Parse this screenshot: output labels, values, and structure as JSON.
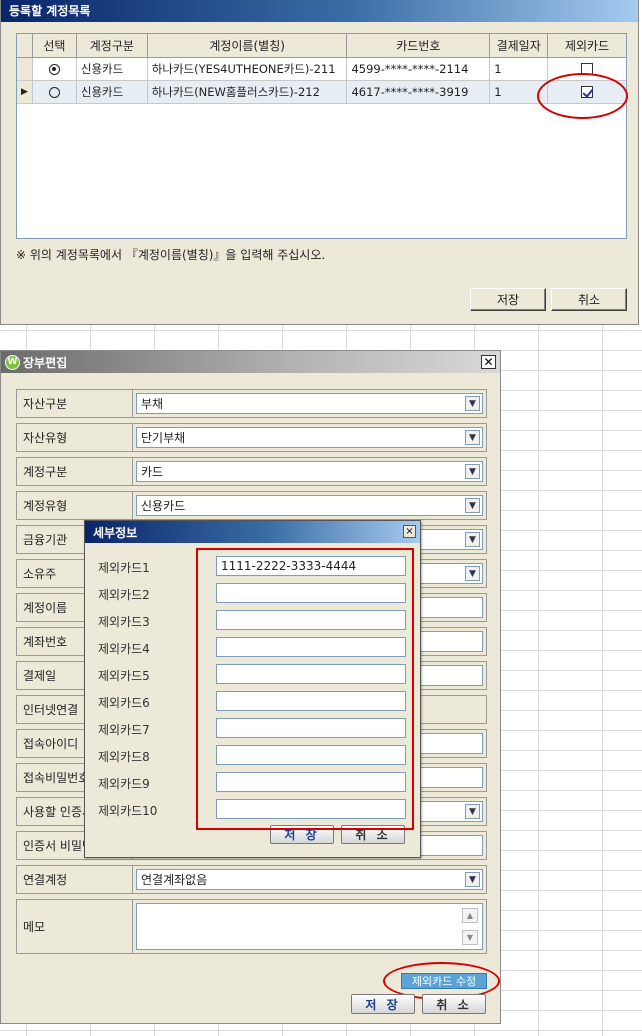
{
  "top_window": {
    "title": "등록할 계정목록",
    "columns": [
      "선택",
      "계정구분",
      "계정이름(별칭)",
      "카드번호",
      "결제일자",
      "제외카드"
    ],
    "rows": [
      {
        "selected": true,
        "account_type": "신용카드",
        "account_name": "하나카드(YES4UTHEONE카드)-211",
        "card_number": "4599-****-****-2114",
        "pay_day": "1",
        "excluded": false
      },
      {
        "selected": false,
        "account_type": "신용카드",
        "account_name": "하나카드(NEW홈플러스카드)-212",
        "card_number": "4617-****-****-3919",
        "pay_day": "1",
        "excluded": true
      }
    ],
    "notice": "※ 위의 계정목록에서 『계정이름(별칭)』을 입력해 주십시오.",
    "save_label": "저장",
    "cancel_label": "취소"
  },
  "ledger_window": {
    "title": "장부편집",
    "fields": [
      {
        "label": "자산구분",
        "value": "부채"
      },
      {
        "label": "자산유형",
        "value": "단기부채"
      },
      {
        "label": "계정구분",
        "value": "카드"
      },
      {
        "label": "계정유형",
        "value": "신용카드"
      },
      {
        "label": "금융기관",
        "value": ""
      },
      {
        "label": "소유주",
        "value": ""
      },
      {
        "label": "계정이름",
        "value": ""
      },
      {
        "label": "계좌번호",
        "value": ""
      },
      {
        "label": "결제일",
        "value": ""
      },
      {
        "label": "인터넷연결",
        "value": ""
      },
      {
        "label": "접속아이디",
        "value": ""
      },
      {
        "label": "접속비밀번호",
        "value": ""
      },
      {
        "label": "사용할 인증서",
        "value": ""
      },
      {
        "label": "인증서 비밀번호",
        "value": ""
      },
      {
        "label": "연결계정",
        "value": "연결계좌없음"
      },
      {
        "label": "메모",
        "value": ""
      }
    ],
    "exclude_card_edit_label": "제외카드 수정",
    "save_label": "저 장",
    "cancel_label": "취 소"
  },
  "detail_popup": {
    "title": "세부정보",
    "fields": [
      {
        "label": "제외카드1",
        "value": "1111-2222-3333-4444"
      },
      {
        "label": "제외카드2",
        "value": ""
      },
      {
        "label": "제외카드3",
        "value": ""
      },
      {
        "label": "제외카드4",
        "value": ""
      },
      {
        "label": "제외카드5",
        "value": ""
      },
      {
        "label": "제외카드6",
        "value": ""
      },
      {
        "label": "제외카드7",
        "value": ""
      },
      {
        "label": "제외카드8",
        "value": ""
      },
      {
        "label": "제외카드9",
        "value": ""
      },
      {
        "label": "제외카드10",
        "value": ""
      }
    ],
    "save_label": "저 장",
    "cancel_label": "취 소",
    "close_glyph": "×"
  },
  "icons": {
    "dropdown": "chevron-down-icon",
    "close": "close-icon",
    "logo": "app-logo-icon"
  },
  "colors": {
    "highlight_red": "#d40000",
    "title_blue": "#0a246a",
    "exclude_button": "#5ba3d6"
  }
}
